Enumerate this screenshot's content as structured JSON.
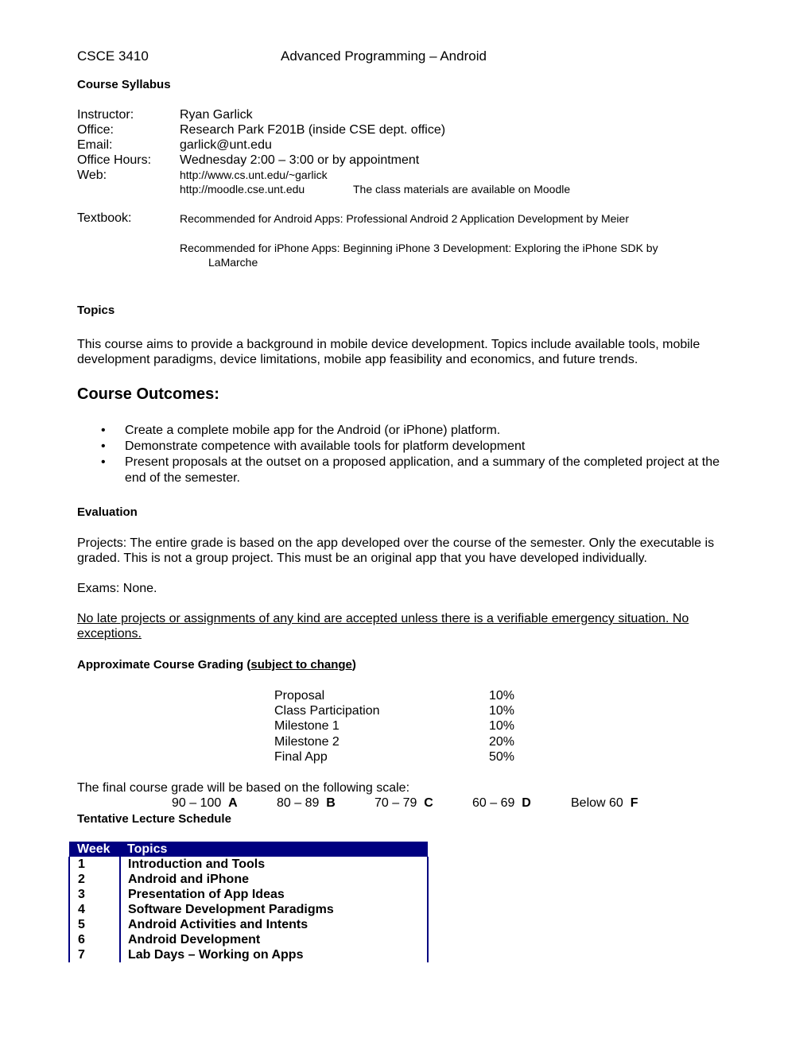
{
  "header": {
    "course_code": "CSCE 3410",
    "course_title": "Advanced Programming – Android",
    "subtitle": "Course Syllabus"
  },
  "info": {
    "instructor_label": "Instructor:",
    "instructor_value": "Ryan Garlick",
    "office_label": "Office:",
    "office_value": "Research Park F201B  (inside CSE dept. office)",
    "email_label": "Email:",
    "email_value": "garlick@unt.edu",
    "hours_label": "Office Hours:",
    "hours_value": "Wednesday 2:00 – 3:00 or by appointment",
    "web_label": "Web:",
    "web_url_1": "http://www.cs.unt.edu/~garlick",
    "web_url_2": "http://moodle.cse.unt.edu",
    "web_note": "The class materials are available on Moodle"
  },
  "textbook": {
    "label": "Textbook:",
    "android": "Recommended for Android Apps: Professional Android 2 Application Development by Meier",
    "iphone_line1": "Recommended for iPhone Apps: Beginning iPhone 3 Development: Exploring the iPhone SDK by",
    "iphone_line2": "LaMarche"
  },
  "topics": {
    "heading": "Topics",
    "body": "This course aims to provide a background in mobile device development. Topics include available tools, mobile development paradigms, device limitations, mobile app feasibility and economics, and future trends."
  },
  "outcomes": {
    "heading": "Course Outcomes:",
    "bullet_glyph": "•",
    "items": [
      "Create a complete mobile app for the Android (or iPhone) platform.",
      "Demonstrate competence with available tools for platform development",
      "Present proposals at the outset on a proposed application, and a summary of the completed project at the end of the semester."
    ]
  },
  "evaluation": {
    "heading": "Evaluation",
    "projects": "Projects: The entire grade is based on the app developed over the course of the semester. Only the executable is graded. This is not a group project. This must be an original app that you have developed individually.",
    "exams": "Exams: None.",
    "late_policy": "No late projects or assignments of any kind are accepted unless there is a verifiable emergency situation. No exceptions."
  },
  "grading": {
    "heading_prefix": "Approximate Course Grading (",
    "heading_link": "subject to change",
    "heading_suffix": ")",
    "items": [
      {
        "name": "Proposal",
        "percent": "10%"
      },
      {
        "name": "Class Participation",
        "percent": "10%"
      },
      {
        "name": "Milestone 1",
        "percent": "10%"
      },
      {
        "name": "Milestone 2",
        "percent": "20%"
      },
      {
        "name": "Final App",
        "percent": "50%"
      }
    ],
    "scale_intro": "The final course grade will be based on the following scale:",
    "scale": [
      {
        "range": "90 – 100",
        "letter": "A"
      },
      {
        "range": "80 – 89",
        "letter": "B"
      },
      {
        "range": "70 – 79",
        "letter": "C"
      },
      {
        "range": "60 – 69",
        "letter": "D"
      },
      {
        "range": "Below 60",
        "letter": "F"
      }
    ]
  },
  "schedule": {
    "heading": "Tentative Lecture Schedule",
    "header_color": "#000080",
    "columns": [
      "Week",
      "Topics"
    ],
    "rows": [
      {
        "week": "1",
        "topic": "Introduction and Tools"
      },
      {
        "week": "2",
        "topic": "Android and iPhone"
      },
      {
        "week": "3",
        "topic": "Presentation of App Ideas"
      },
      {
        "week": "4",
        "topic": "Software Development Paradigms"
      },
      {
        "week": "5",
        "topic": "Android Activities and Intents"
      },
      {
        "week": "6",
        "topic": "Android Development"
      },
      {
        "week": "7",
        "topic": "Lab Days – Working on Apps"
      }
    ]
  }
}
